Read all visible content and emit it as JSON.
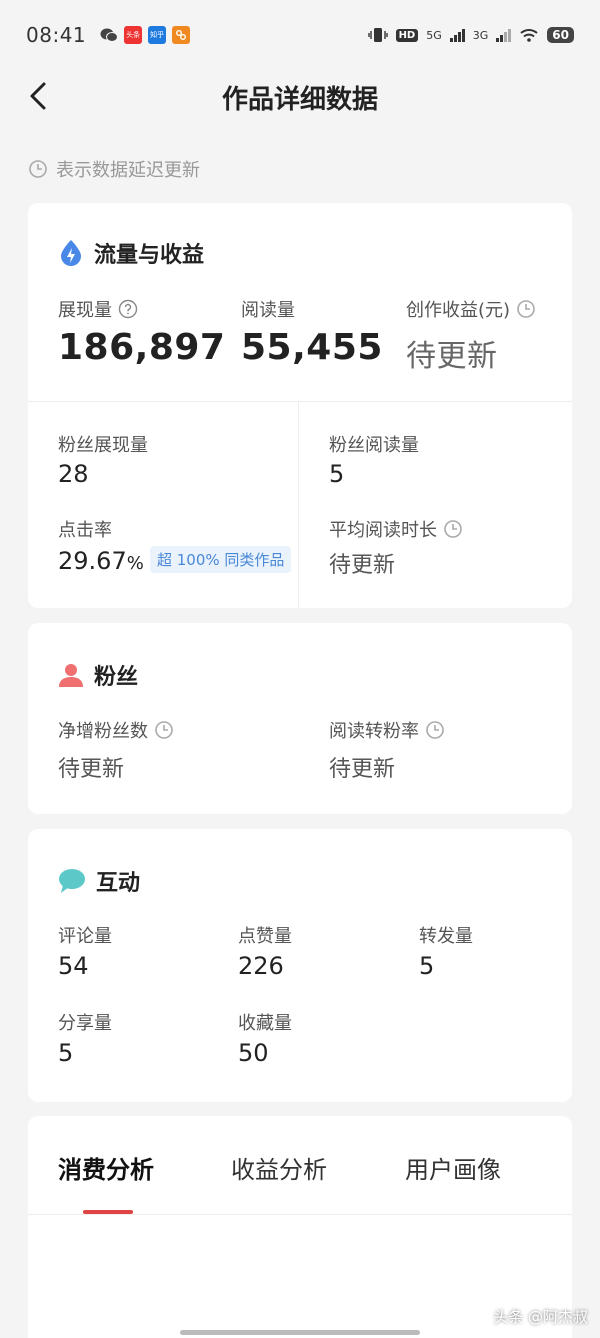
{
  "status_bar": {
    "time": "08:41",
    "apps": [
      "wechat-icon",
      "toutiao-icon",
      "zhihu-icon",
      "app-icon"
    ],
    "app_labels": [
      "",
      "头条",
      "知乎",
      ""
    ],
    "hd": "HD",
    "net1": "5G",
    "net2": "3G",
    "battery": "60"
  },
  "nav": {
    "title": "作品详细数据"
  },
  "delay_note": "表示数据延迟更新",
  "traffic": {
    "title": "流量与收益",
    "impressions_label": "展现量",
    "impressions_value": "186,897",
    "reads_label": "阅读量",
    "reads_value": "55,455",
    "earnings_label": "创作收益(元)",
    "earnings_value": "待更新",
    "fan_impressions_label": "粉丝展现量",
    "fan_impressions_value": "28",
    "fan_reads_label": "粉丝阅读量",
    "fan_reads_value": "5",
    "ctr_label": "点击率",
    "ctr_value": "29.67",
    "ctr_unit": "%",
    "ctr_tag": "超 100% 同类作品",
    "avg_read_label": "平均阅读时长",
    "avg_read_value": "待更新"
  },
  "fans": {
    "title": "粉丝",
    "net_fans_label": "净增粉丝数",
    "net_fans_value": "待更新",
    "conversion_label": "阅读转粉率",
    "conversion_value": "待更新"
  },
  "interaction": {
    "title": "互动",
    "comments_label": "评论量",
    "comments_value": "54",
    "likes_label": "点赞量",
    "likes_value": "226",
    "reposts_label": "转发量",
    "reposts_value": "5",
    "shares_label": "分享量",
    "shares_value": "5",
    "favorites_label": "收藏量",
    "favorites_value": "50"
  },
  "tabs": [
    {
      "label": "消费分析",
      "active": true
    },
    {
      "label": "收益分析",
      "active": false
    },
    {
      "label": "用户画像",
      "active": false
    }
  ],
  "watermark": "头条 @阿杰叔",
  "colors": {
    "accent_red": "#e04545",
    "traffic_icon": "#4a88e8",
    "fans_icon": "#f07070",
    "interaction_icon": "#5cc8c8",
    "tag_bg": "#eaf2fc",
    "tag_text": "#4a88d8"
  }
}
